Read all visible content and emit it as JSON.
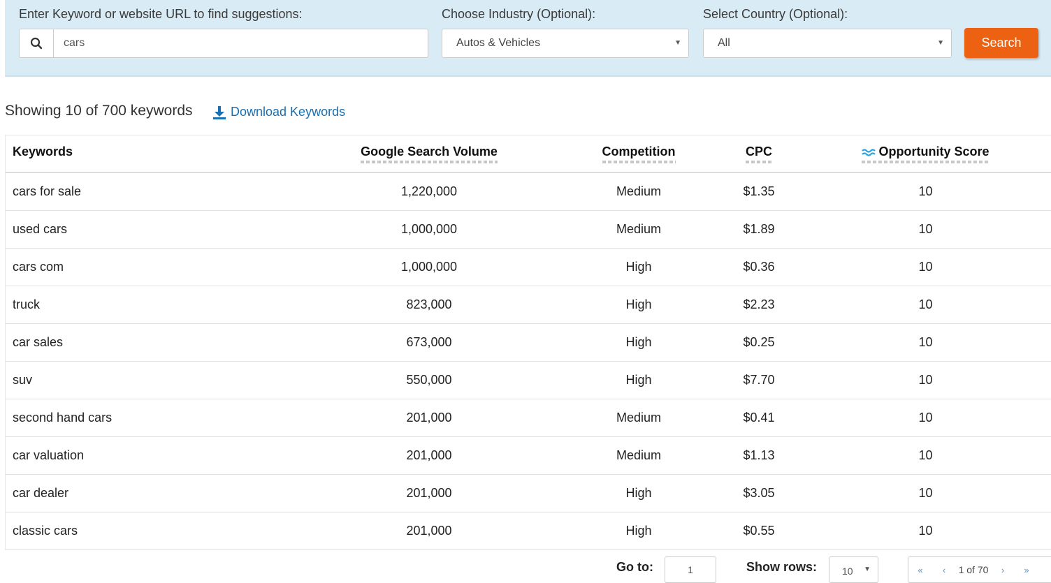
{
  "search": {
    "keyword_label": "Enter Keyword or website URL to find suggestions:",
    "keyword_value": "cars",
    "industry_label": "Choose Industry (Optional):",
    "industry_value": "Autos & Vehicles",
    "country_label": "Select Country (Optional):",
    "country_value": "All",
    "search_button": "Search",
    "icons": {
      "search": "search-icon",
      "dropdown": "caret-down-icon"
    },
    "accent_color": "#ec6212"
  },
  "results": {
    "summary": "Showing 10 of 700 keywords",
    "download_label": "Download Keywords",
    "download_icon": "download-icon",
    "link_color": "#1a6fb0"
  },
  "table": {
    "columns": [
      "Keywords",
      "Google Search Volume",
      "Competition",
      "CPC",
      "Opportunity Score"
    ],
    "opportunity_icon": "wave-icon",
    "rows": [
      {
        "keyword": "cars for sale",
        "volume": "1,220,000",
        "competition": "Medium",
        "cpc": "$1.35",
        "score": "10"
      },
      {
        "keyword": "used cars",
        "volume": "1,000,000",
        "competition": "Medium",
        "cpc": "$1.89",
        "score": "10"
      },
      {
        "keyword": "cars com",
        "volume": "1,000,000",
        "competition": "High",
        "cpc": "$0.36",
        "score": "10"
      },
      {
        "keyword": "truck",
        "volume": "823,000",
        "competition": "High",
        "cpc": "$2.23",
        "score": "10"
      },
      {
        "keyword": "car sales",
        "volume": "673,000",
        "competition": "High",
        "cpc": "$0.25",
        "score": "10"
      },
      {
        "keyword": "suv",
        "volume": "550,000",
        "competition": "High",
        "cpc": "$7.70",
        "score": "10"
      },
      {
        "keyword": "second hand cars",
        "volume": "201,000",
        "competition": "Medium",
        "cpc": "$0.41",
        "score": "10"
      },
      {
        "keyword": "car valuation",
        "volume": "201,000",
        "competition": "Medium",
        "cpc": "$1.13",
        "score": "10"
      },
      {
        "keyword": "car dealer",
        "volume": "201,000",
        "competition": "High",
        "cpc": "$3.05",
        "score": "10"
      },
      {
        "keyword": "classic cars",
        "volume": "201,000",
        "competition": "High",
        "cpc": "$0.55",
        "score": "10"
      }
    ]
  },
  "pagination": {
    "goto_label": "Go to:",
    "goto_value": "1",
    "rows_label": "Show rows:",
    "rows_value": "10",
    "first": "«",
    "prev": "‹",
    "status": "1 of 70",
    "next": "›",
    "last": "»"
  }
}
